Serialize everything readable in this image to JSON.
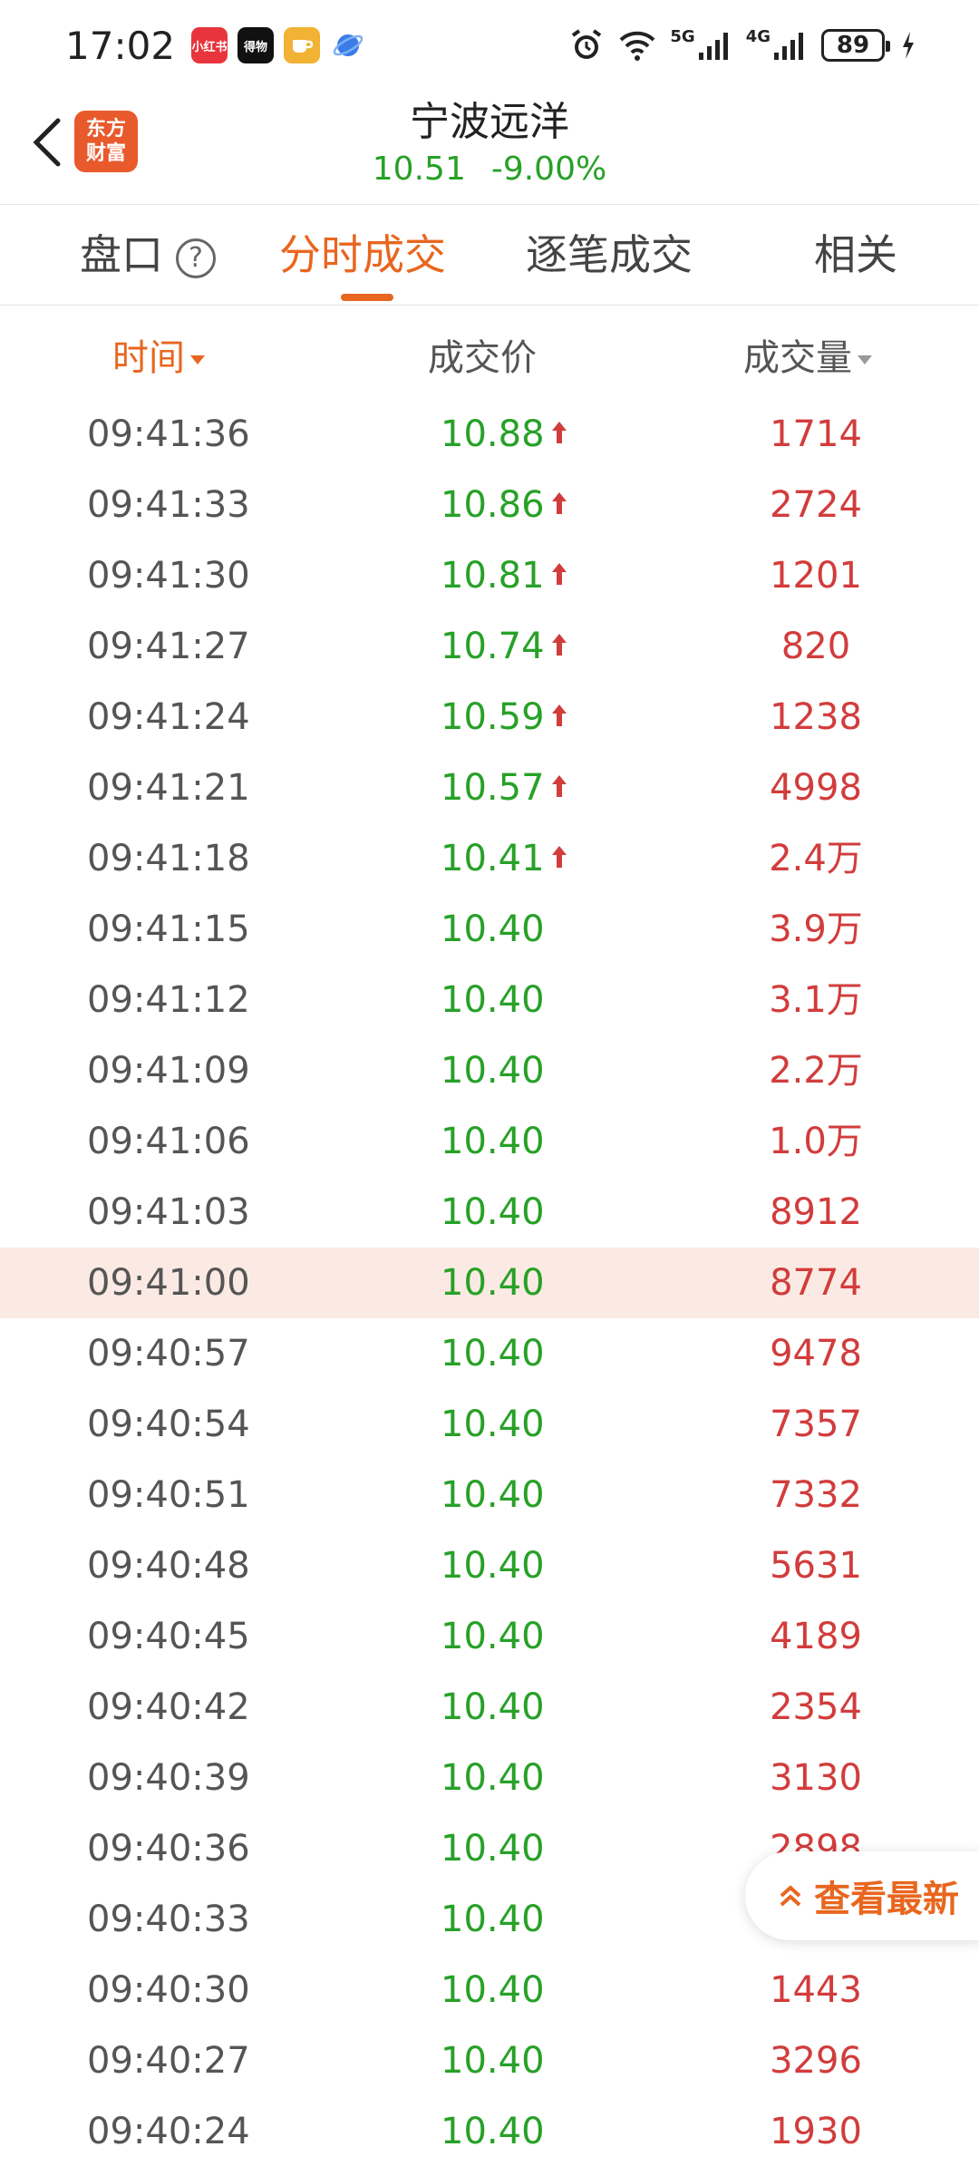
{
  "status_bar": {
    "time": "17:02",
    "notif_icons": [
      {
        "name": "xiaohongshu-icon",
        "label": "小红书",
        "color": "#e8343c"
      },
      {
        "name": "dewu-icon",
        "label": "得物",
        "color": "#111111"
      },
      {
        "name": "cup-app-icon",
        "label": "",
        "color": "#f2b233"
      },
      {
        "name": "browser-icon",
        "label": "",
        "color": "#3b7de8"
      }
    ],
    "network_5g": "5G",
    "network_4g": "4G",
    "battery": "89"
  },
  "header": {
    "logo_line1": "东方",
    "logo_line2": "财富",
    "stock_name": "宁波远洋",
    "price": "10.51",
    "change": "-9.00%"
  },
  "tabs": [
    {
      "label": "盘口",
      "active": false
    },
    {
      "label": "分时成交",
      "active": true
    },
    {
      "label": "逐笔成交",
      "active": false
    },
    {
      "label": "相关",
      "active": false
    }
  ],
  "help_icon_glyph": "?",
  "columns": {
    "time": "时间",
    "price": "成交价",
    "volume": "成交量"
  },
  "rows": [
    {
      "time": "09:41:36",
      "price": "10.88",
      "volume": "1714",
      "up": true
    },
    {
      "time": "09:41:33",
      "price": "10.86",
      "volume": "2724",
      "up": true
    },
    {
      "time": "09:41:30",
      "price": "10.81",
      "volume": "1201",
      "up": true
    },
    {
      "time": "09:41:27",
      "price": "10.74",
      "volume": "820",
      "up": true
    },
    {
      "time": "09:41:24",
      "price": "10.59",
      "volume": "1238",
      "up": true
    },
    {
      "time": "09:41:21",
      "price": "10.57",
      "volume": "4998",
      "up": true
    },
    {
      "time": "09:41:18",
      "price": "10.41",
      "volume": "2.4万",
      "up": true
    },
    {
      "time": "09:41:15",
      "price": "10.40",
      "volume": "3.9万",
      "up": false
    },
    {
      "time": "09:41:12",
      "price": "10.40",
      "volume": "3.1万",
      "up": false
    },
    {
      "time": "09:41:09",
      "price": "10.40",
      "volume": "2.2万",
      "up": false
    },
    {
      "time": "09:41:06",
      "price": "10.40",
      "volume": "1.0万",
      "up": false
    },
    {
      "time": "09:41:03",
      "price": "10.40",
      "volume": "8912",
      "up": false
    },
    {
      "time": "09:41:00",
      "price": "10.40",
      "volume": "8774",
      "up": false,
      "highlight": true
    },
    {
      "time": "09:40:57",
      "price": "10.40",
      "volume": "9478",
      "up": false
    },
    {
      "time": "09:40:54",
      "price": "10.40",
      "volume": "7357",
      "up": false
    },
    {
      "time": "09:40:51",
      "price": "10.40",
      "volume": "7332",
      "up": false
    },
    {
      "time": "09:40:48",
      "price": "10.40",
      "volume": "5631",
      "up": false
    },
    {
      "time": "09:40:45",
      "price": "10.40",
      "volume": "4189",
      "up": false
    },
    {
      "time": "09:40:42",
      "price": "10.40",
      "volume": "2354",
      "up": false
    },
    {
      "time": "09:40:39",
      "price": "10.40",
      "volume": "3130",
      "up": false
    },
    {
      "time": "09:40:36",
      "price": "10.40",
      "volume": "2898",
      "up": false
    },
    {
      "time": "09:40:33",
      "price": "10.40",
      "volume": "",
      "up": false
    },
    {
      "time": "09:40:30",
      "price": "10.40",
      "volume": "1443",
      "up": false
    },
    {
      "time": "09:40:27",
      "price": "10.40",
      "volume": "3296",
      "up": false
    },
    {
      "time": "09:40:24",
      "price": "10.40",
      "volume": "1930",
      "up": false
    }
  ],
  "latest_button": "查看最新",
  "colors": {
    "accent": "#e8661f",
    "up_red": "#d23c3c",
    "price_green": "#27a127",
    "highlight_row": "#fbeae3"
  }
}
